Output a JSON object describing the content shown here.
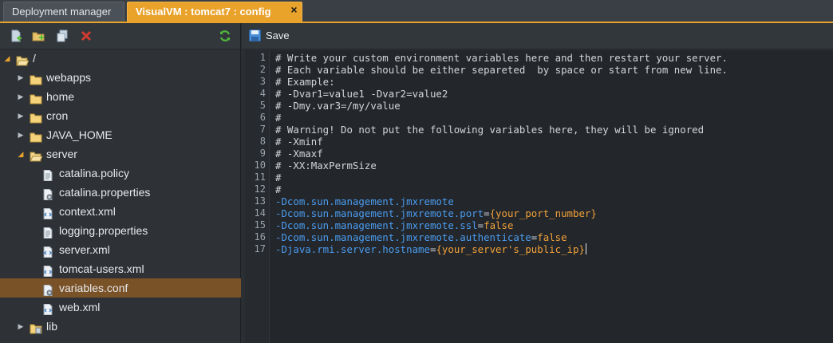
{
  "tabs": [
    {
      "label": "Deployment manager",
      "active": false
    },
    {
      "label": "VisualVM : tomcat7 : config",
      "active": true,
      "close_glyph": "×"
    }
  ],
  "left_toolbar": {
    "buttons": [
      "new-file-icon",
      "new-folder-icon",
      "copy-icon",
      "delete-icon",
      "refresh-icon"
    ]
  },
  "tree": {
    "root": "/",
    "items": [
      {
        "label": "webapps",
        "type": "folder"
      },
      {
        "label": "home",
        "type": "folder"
      },
      {
        "label": "cron",
        "type": "folder"
      },
      {
        "label": "JAVA_HOME",
        "type": "folder"
      },
      {
        "label": "server",
        "type": "folder",
        "expanded": true
      },
      {
        "label": "catalina.policy",
        "type": "file"
      },
      {
        "label": "catalina.properties",
        "type": "file-config"
      },
      {
        "label": "context.xml",
        "type": "file-xml"
      },
      {
        "label": "logging.properties",
        "type": "file"
      },
      {
        "label": "server.xml",
        "type": "file-xml"
      },
      {
        "label": "tomcat-users.xml",
        "type": "file-xml"
      },
      {
        "label": "variables.conf",
        "type": "file-config",
        "selected": true
      },
      {
        "label": "web.xml",
        "type": "file-xml"
      },
      {
        "label": "lib",
        "type": "folder-lib"
      }
    ]
  },
  "editor": {
    "toolbar": {
      "save_label": "Save"
    },
    "colors": {
      "comment": "#d2d6da",
      "key": "#4b9cf0",
      "value": "#f2a23a",
      "accent": "#e9a22a",
      "selection": "#7a5228"
    },
    "lines": [
      {
        "n": "1",
        "comment": "# Write your custom environment variables here and then restart your server."
      },
      {
        "n": "2",
        "comment": "# Each variable should be either separeted  by space or start from new line."
      },
      {
        "n": "3",
        "comment": "# Example:"
      },
      {
        "n": "4",
        "comment": "# -Dvar1=value1 -Dvar2=value2"
      },
      {
        "n": "5",
        "comment": "# -Dmy.var3=/my/value"
      },
      {
        "n": "6",
        "comment": "#"
      },
      {
        "n": "7",
        "comment": "# Warning! Do not put the following variables here, they will be ignored"
      },
      {
        "n": "8",
        "comment": "# -Xminf"
      },
      {
        "n": "9",
        "comment": "# -Xmaxf"
      },
      {
        "n": "10",
        "comment": "# -XX:MaxPermSize"
      },
      {
        "n": "11",
        "comment": "#"
      },
      {
        "n": "12",
        "comment": "#"
      },
      {
        "n": "13",
        "key": "-Dcom.sun.management.jmxremote"
      },
      {
        "n": "14",
        "key": "-Dcom.sun.management.jmxremote.port",
        "eq": "=",
        "value": "{your_port_number}"
      },
      {
        "n": "15",
        "key": "-Dcom.sun.management.jmxremote.ssl",
        "eq": "=",
        "value": "false"
      },
      {
        "n": "16",
        "key": "-Dcom.sun.management.jmxremote.authenticate",
        "eq": "=",
        "value": "false"
      },
      {
        "n": "17",
        "key": "-Djava.rmi.server.hostname",
        "eq": "=",
        "value": "{your_server's_public_ip}",
        "cursor": true
      }
    ]
  }
}
